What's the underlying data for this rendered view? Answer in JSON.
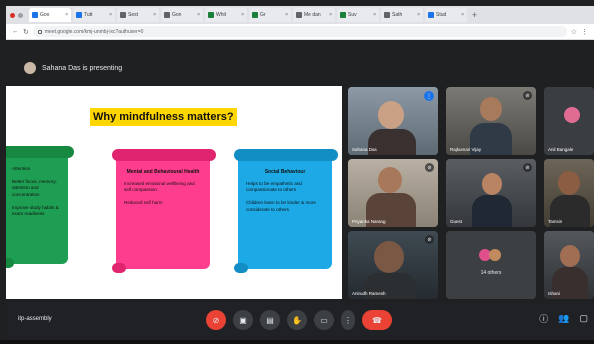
{
  "browser": {
    "tabs": [
      {
        "label": "Goo",
        "active": true
      },
      {
        "label": "Tutt"
      },
      {
        "label": "Sest"
      },
      {
        "label": "Gon"
      },
      {
        "label": "Whit"
      },
      {
        "label": "Gr"
      },
      {
        "label": "Me dan"
      },
      {
        "label": "Suv"
      },
      {
        "label": "Sath"
      },
      {
        "label": "Stud"
      }
    ],
    "new_tab": "+",
    "url": "meet.google.com/kmj-unmbj-ixc?authuser=0"
  },
  "meet": {
    "presenting_text": "Sahana Das is presenting",
    "meeting_code": "itp-assembly",
    "others_label": "14 others"
  },
  "slide": {
    "title": "Why mindfulness matters?",
    "cards": [
      {
        "id": "green",
        "paragraphs": [
          "Attention",
          "Better focus, memory, attention and concentration",
          "Improve study habits & exam readiness"
        ]
      },
      {
        "id": "pink",
        "heading": "Mental and Behavioural Health",
        "paragraphs": [
          "Increased emotional wellbeing and self compassion",
          "Reduced self harm"
        ]
      },
      {
        "id": "blue",
        "heading": "Social Behaviour",
        "paragraphs": [
          "Helps to be empathetic and compassionate to others",
          "Children learn to be kinder & more considerate to others"
        ]
      }
    ]
  },
  "participants": [
    {
      "name": "Sahana Das",
      "speaking": true
    },
    {
      "name": "Rajkumari Vijay"
    },
    {
      "name": "Anil Bangale"
    },
    {
      "name": "Priyanka Narang"
    },
    {
      "name": "Guest"
    },
    {
      "name": "Tamsin"
    },
    {
      "name": "Anirudh Ramesh"
    },
    {
      "name": "Ishani"
    }
  ],
  "colors": {
    "slide_title_bg": "#ffd600",
    "card_green": "#1e9e52",
    "card_pink": "#ff3d8e",
    "card_blue": "#1ca9e6",
    "end_call": "#ea4335",
    "speaking_outline": "#8ab4f8"
  },
  "icons": {
    "mic": "mic-off-icon",
    "camera": "camera-icon",
    "captions": "captions-icon",
    "raise_hand": "hand-icon",
    "present": "present-screen-icon",
    "more": "more-options-icon",
    "end": "end-call-icon",
    "info": "info-icon",
    "people": "people-icon",
    "chat": "chat-icon"
  }
}
